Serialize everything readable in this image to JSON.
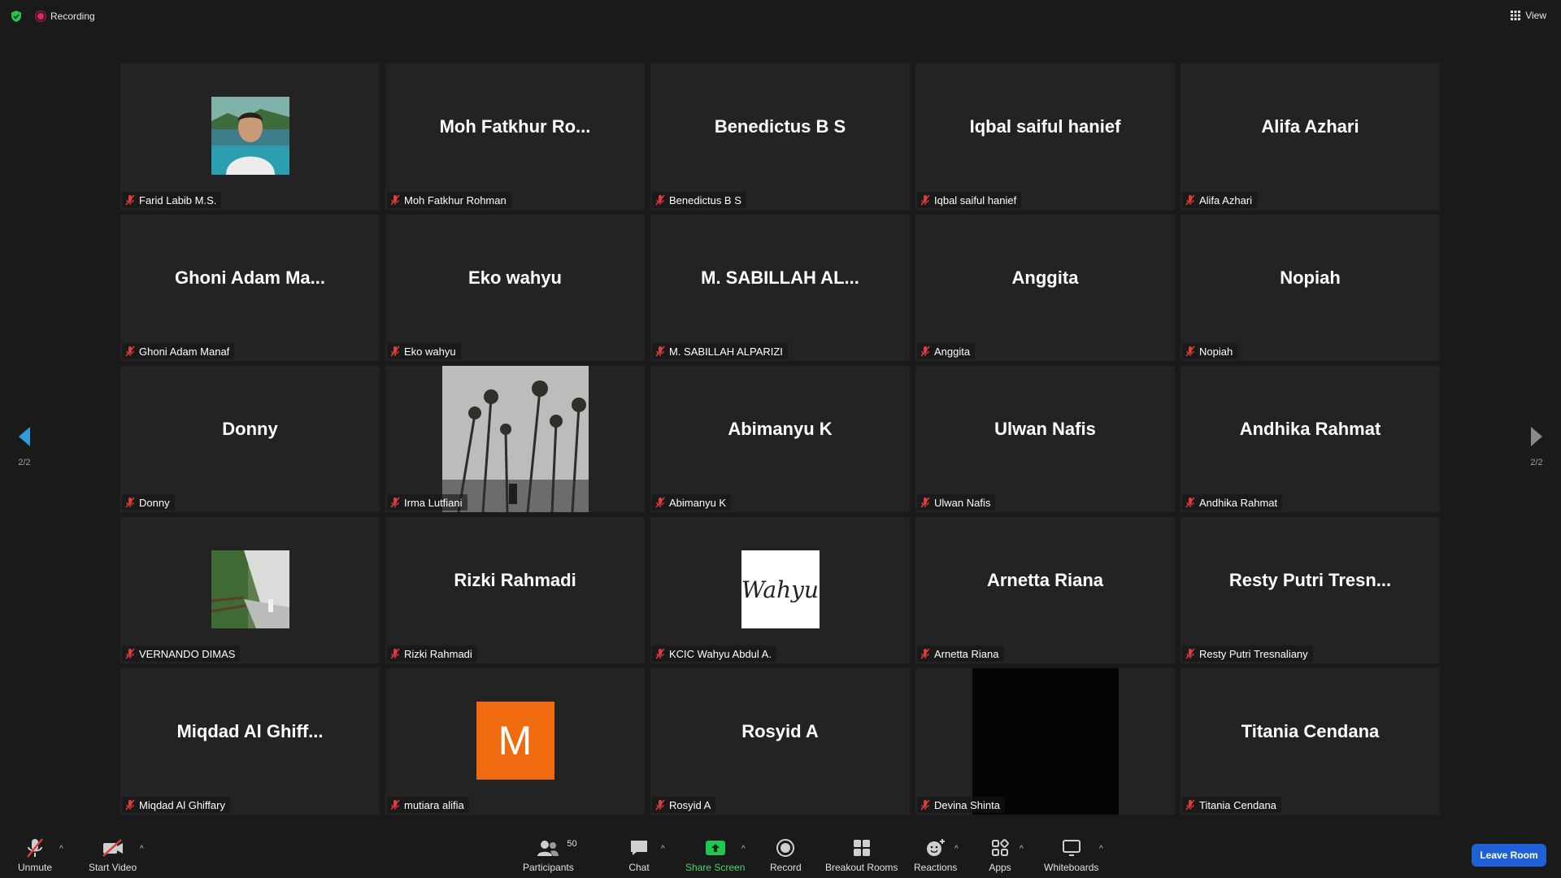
{
  "top": {
    "recording_label": "Recording",
    "view_label": "View"
  },
  "pager": {
    "left_text": "2/2",
    "right_text": "2/2"
  },
  "tiles": [
    {
      "big": "",
      "label": "Farid Labib M.S."
    },
    {
      "big": "Moh  Fatkhur  Ro...",
      "label": "Moh Fatkhur Rohman"
    },
    {
      "big": "Benedictus B S",
      "label": "Benedictus B S"
    },
    {
      "big": "Iqbal saiful hanief",
      "label": "Iqbal saiful hanief"
    },
    {
      "big": "Alifa Azhari",
      "label": "Alifa Azhari"
    },
    {
      "big": "Ghoni  Adam  Ma...",
      "label": "Ghoni Adam Manaf"
    },
    {
      "big": "Eko wahyu",
      "label": "Eko wahyu"
    },
    {
      "big": "M.  SABILLAH  AL...",
      "label": "M. SABILLAH ALPARIZI"
    },
    {
      "big": "Anggita",
      "label": "Anggita"
    },
    {
      "big": "Nopiah",
      "label": "Nopiah"
    },
    {
      "big": "Donny",
      "label": "Donny"
    },
    {
      "big": "",
      "label": "Irma Lutfiani"
    },
    {
      "big": "Abimanyu K",
      "label": "Abimanyu K"
    },
    {
      "big": "Ulwan Nafis",
      "label": "Ulwan Nafis"
    },
    {
      "big": "Andhika Rahmat",
      "label": "Andhika Rahmat"
    },
    {
      "big": "",
      "label": "VERNANDO DIMAS"
    },
    {
      "big": "Rizki Rahmadi",
      "label": "Rizki Rahmadi"
    },
    {
      "big": "",
      "label": "KCIC Wahyu Abdul A.",
      "avatar_text": "Wahyu"
    },
    {
      "big": "Arnetta Riana",
      "label": "Arnetta Riana"
    },
    {
      "big": "Resty  Putri  Tresn...",
      "label": "Resty Putri Tresnaliany"
    },
    {
      "big": "Miqdad  Al  Ghiff...",
      "label": "Miqdad Al Ghiffary"
    },
    {
      "big": "",
      "label": "mutiara alifia",
      "avatar_text": "M"
    },
    {
      "big": "Rosyid A",
      "label": "Rosyid A"
    },
    {
      "big": "",
      "label": "Devina Shinta"
    },
    {
      "big": "Titania Cendana",
      "label": "Titania Cendana"
    }
  ],
  "toolbar": {
    "unmute": "Unmute",
    "start_video": "Start Video",
    "participants": "Participants",
    "participant_count": "50",
    "chat": "Chat",
    "share_screen": "Share Screen",
    "record": "Record",
    "breakout_rooms": "Breakout Rooms",
    "reactions": "Reactions",
    "apps": "Apps",
    "whiteboards": "Whiteboards",
    "leave_room": "Leave Room"
  },
  "colors": {
    "accent_blue": "#1f60d6",
    "share_green": "#4cd46b",
    "muted_red": "#e03c3c",
    "avatar_orange": "#f06a10"
  }
}
